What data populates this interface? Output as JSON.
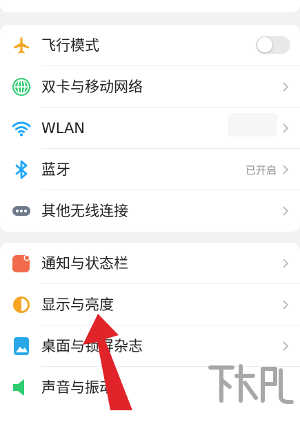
{
  "group1": {
    "items": [
      {
        "label": "飞行模式",
        "icon": "airplane-icon",
        "control": "toggle",
        "toggle_on": false
      },
      {
        "label": "双卡与移动网络",
        "icon": "globe-icon",
        "control": "chevron"
      },
      {
        "label": "WLAN",
        "icon": "wifi-icon",
        "control": "chevron"
      },
      {
        "label": "蓝牙",
        "icon": "bluetooth-icon",
        "control": "chevron",
        "status": "已开启"
      },
      {
        "label": "其他无线连接",
        "icon": "more-connections-icon",
        "control": "chevron"
      }
    ]
  },
  "group2": {
    "items": [
      {
        "label": "通知与状态栏",
        "icon": "notification-icon",
        "control": "chevron"
      },
      {
        "label": "显示与亮度",
        "icon": "brightness-icon",
        "control": "chevron"
      },
      {
        "label": "桌面与锁屏杂志",
        "icon": "wallpaper-icon",
        "control": "chevron"
      },
      {
        "label": "声音与振动",
        "icon": "sound-icon",
        "control": "chevron"
      }
    ]
  },
  "colors": {
    "airplane": "#f5a623",
    "globe": "#2ecc71",
    "wifi": "#1ea7fd",
    "bluetooth": "#1ea7fd",
    "more": "#6c7a89",
    "notification": "#f26b4a",
    "brightness": "#f5a623",
    "wallpaper": "#29a8e8",
    "sound": "#2ecc71",
    "annotation_arrow": "#e0242a"
  }
}
